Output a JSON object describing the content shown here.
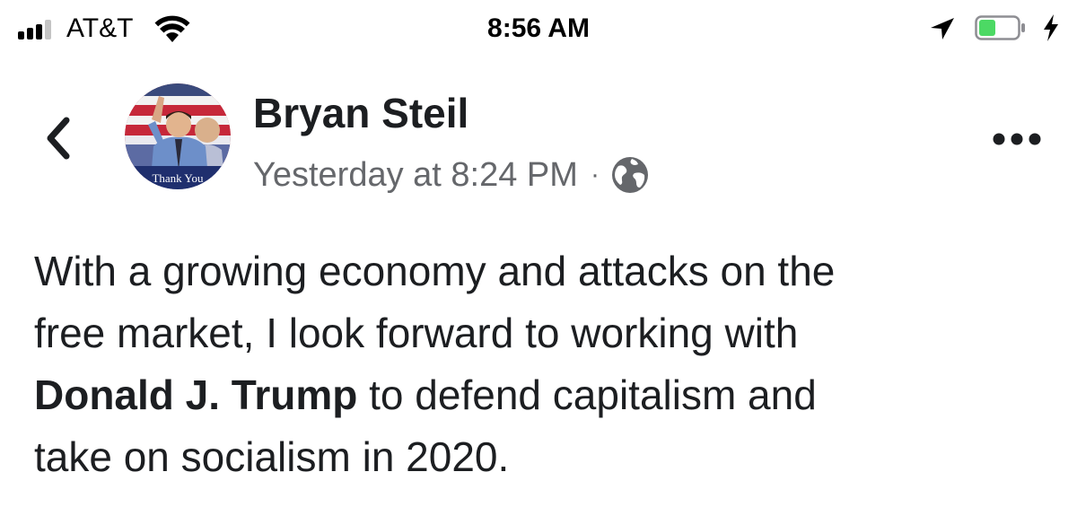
{
  "status_bar": {
    "carrier": "AT&T",
    "time": "8:56 AM",
    "signal_bars_filled": 3,
    "signal_bars_total": 4,
    "battery_level": 0.45,
    "battery_color": "#4cd964",
    "icons": [
      "signal-icon",
      "wifi-icon",
      "location-arrow-icon",
      "battery-icon",
      "charging-bolt-icon"
    ]
  },
  "post": {
    "author": "Bryan Steil",
    "timestamp": "Yesterday at 8:24 PM",
    "separator": "·",
    "audience_icon": "globe-icon",
    "avatar_caption": "Thank You",
    "body": {
      "line1": "With a growing economy and attacks on the",
      "line2": "free market, I look forward to working with",
      "mention": "Donald J. Trump",
      "line3_rest": " to defend capitalism and",
      "line4": "take on socialism in 2020."
    }
  },
  "nav": {
    "back_icon": "chevron-left-icon",
    "more_icon": "more-options-icon"
  },
  "colors": {
    "text_primary": "#1c1e21",
    "text_secondary": "#65676b",
    "status_text": "#000000"
  }
}
